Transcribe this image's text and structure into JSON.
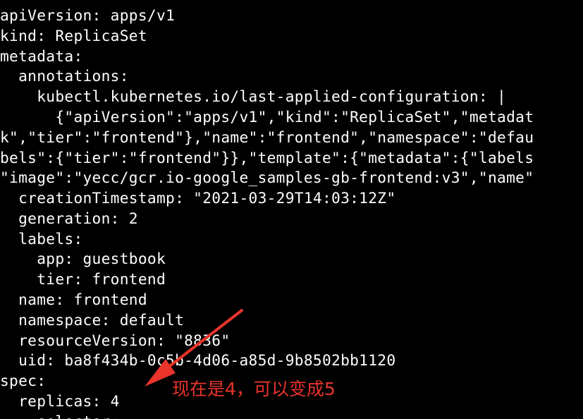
{
  "terminal": {
    "lines": [
      "\"",
      "apiVersion: apps/v1",
      "kind: ReplicaSet",
      "metadata:",
      "  annotations:",
      "    kubectl.kubernetes.io/last-applied-configuration: |",
      "      {\"apiVersion\":\"apps/v1\",\"kind\":\"ReplicaSet\",\"metadat",
      "k\",\"tier\":\"frontend\"},\"name\":\"frontend\",\"namespace\":\"defau",
      "bels\":{\"tier\":\"frontend\"}},\"template\":{\"metadata\":{\"labels",
      "\"image\":\"yecc/gcr.io-google_samples-gb-frontend:v3\",\"name\"",
      "  creationTimestamp: \"2021-03-29T14:03:12Z\"",
      "  generation: 2",
      "  labels:",
      "    app: guestbook",
      "    tier: frontend",
      "  name: frontend",
      "  namespace: default",
      "  resourceVersion: \"8836\"",
      "  uid: ba8f434b-0c5b-4d06-a85d-9b8502bb1120",
      "spec:",
      "  replicas: 4",
      "    selector:"
    ]
  },
  "annotation": {
    "text": "现在是4，可以变成5",
    "color": "#e8342b"
  }
}
